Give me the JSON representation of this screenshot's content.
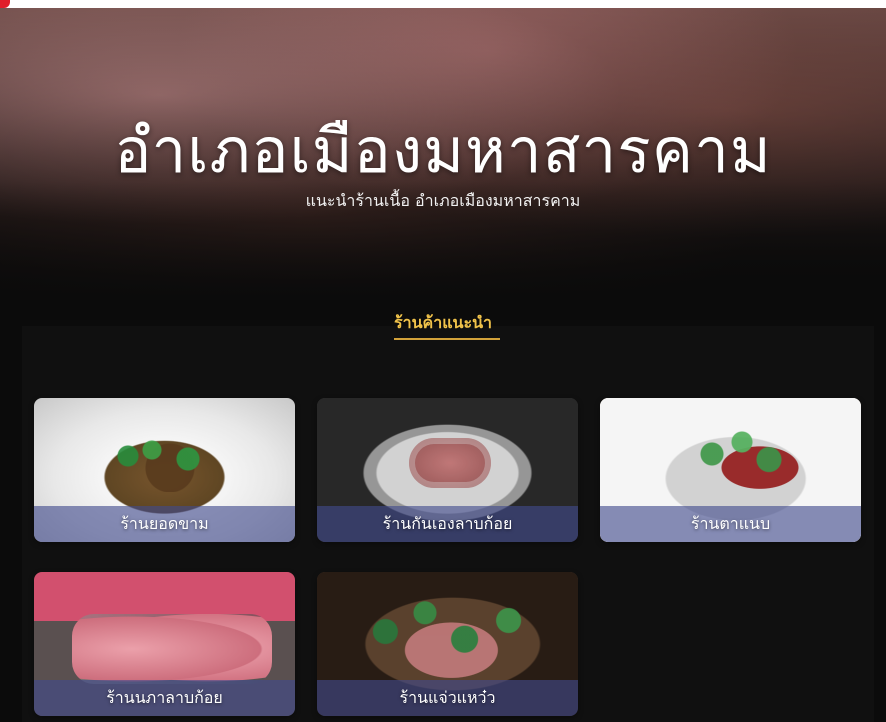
{
  "header": {
    "title": "อำเภอเมืองมหาสารคาม",
    "subtitle": "แนะนำร้านเนื้อ อำเภอเมืองมหาสารคาม"
  },
  "section": {
    "title": "ร้านค้าแนะนำ"
  },
  "shops": [
    {
      "name": "ร้านยอดขาม"
    },
    {
      "name": "ร้านกันเองลาบก้อย"
    },
    {
      "name": "ร้านตาแนบ"
    },
    {
      "name": "ร้านนภาลาบก้อย"
    },
    {
      "name": "ร้านแจ่วแหว๋ว"
    }
  ],
  "colors": {
    "accent": "#f0c24a",
    "card_caption_bg": "#404a8c",
    "brand": "#e11d2a"
  }
}
